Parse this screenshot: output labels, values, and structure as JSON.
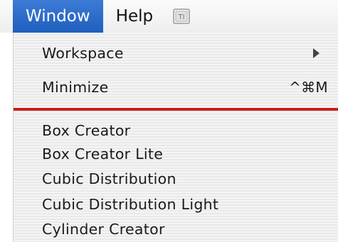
{
  "menubar": {
    "items": [
      {
        "label": "Window",
        "active": true
      },
      {
        "label": "Help",
        "active": false
      }
    ],
    "icon": "script-menu-icon"
  },
  "menu": {
    "items": [
      {
        "label": "Workspace",
        "submenu": true
      },
      {
        "label": "Minimize",
        "shortcut": "^⌘M"
      }
    ],
    "plugins": [
      {
        "label": "Box Creator"
      },
      {
        "label": "Box Creator Lite"
      },
      {
        "label": "Cubic Distribution"
      },
      {
        "label": "Cubic Distribution Light"
      },
      {
        "label": "Cylinder Creator"
      }
    ]
  },
  "colors": {
    "active_menu": "#2a6bcc",
    "separator": "#c81e1e"
  }
}
